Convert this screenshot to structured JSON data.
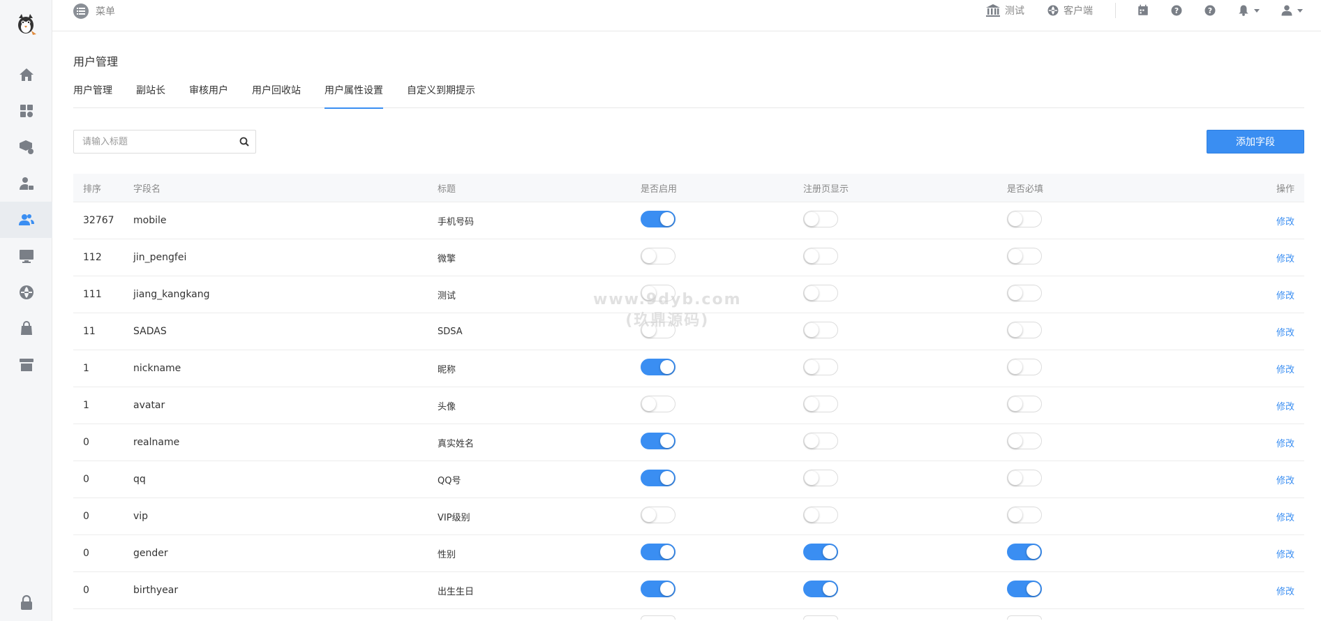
{
  "topbar": {
    "menu_label": "菜单",
    "links": [
      {
        "label": "测试",
        "icon": "bank-icon"
      },
      {
        "label": "客户端",
        "icon": "globe-icon"
      }
    ],
    "icons": [
      "calendar-icon",
      "help-icon",
      "help-icon",
      "bell-icon",
      "user-icon"
    ]
  },
  "sidebar": {
    "items": [
      {
        "icon": "home-icon"
      },
      {
        "icon": "apps-settings-icon"
      },
      {
        "icon": "package-settings-icon"
      },
      {
        "icon": "user-lock-icon"
      },
      {
        "icon": "users-icon",
        "active": true
      },
      {
        "icon": "monitor-icon"
      },
      {
        "icon": "globe-icon"
      },
      {
        "icon": "shopping-bag-icon"
      },
      {
        "icon": "store-icon"
      },
      {
        "icon": "lock-icon"
      }
    ]
  },
  "page": {
    "title": "用户管理",
    "tabs": [
      "用户管理",
      "副站长",
      "审核用户",
      "用户回收站",
      "用户属性设置",
      "自定义到期提示"
    ],
    "active_tab": "用户属性设置"
  },
  "search": {
    "placeholder": "请输入标题"
  },
  "add_button": "添加字段",
  "table": {
    "headers": {
      "sort": "排序",
      "field": "字段名",
      "title": "标题",
      "enabled": "是否启用",
      "register": "注册页显示",
      "required": "是否必填",
      "op": "操作"
    },
    "op_label": "修改",
    "rows": [
      {
        "sort": "32767",
        "field": "mobile",
        "title": "手机号码",
        "enabled": true,
        "register": false,
        "required": false
      },
      {
        "sort": "112",
        "field": "jin_pengfei",
        "title": "微擎",
        "enabled": false,
        "register": false,
        "required": false
      },
      {
        "sort": "111",
        "field": "jiang_kangkang",
        "title": "测试",
        "enabled": false,
        "register": false,
        "required": false
      },
      {
        "sort": "11",
        "field": "SADAS",
        "title": "SDSA",
        "enabled": false,
        "register": false,
        "required": false
      },
      {
        "sort": "1",
        "field": "nickname",
        "title": "昵称",
        "enabled": true,
        "register": false,
        "required": false
      },
      {
        "sort": "1",
        "field": "avatar",
        "title": "头像",
        "enabled": false,
        "register": false,
        "required": false
      },
      {
        "sort": "0",
        "field": "realname",
        "title": "真实姓名",
        "enabled": true,
        "register": false,
        "required": false
      },
      {
        "sort": "0",
        "field": "qq",
        "title": "QQ号",
        "enabled": true,
        "register": false,
        "required": false
      },
      {
        "sort": "0",
        "field": "vip",
        "title": "VIP级别",
        "enabled": false,
        "register": false,
        "required": false
      },
      {
        "sort": "0",
        "field": "gender",
        "title": "性别",
        "enabled": true,
        "register": true,
        "required": true
      },
      {
        "sort": "0",
        "field": "birthyear",
        "title": "出生生日",
        "enabled": true,
        "register": true,
        "required": true
      }
    ]
  },
  "watermark": {
    "line1": "www.9dyb.com",
    "line2": "(玖鼎源码)"
  }
}
